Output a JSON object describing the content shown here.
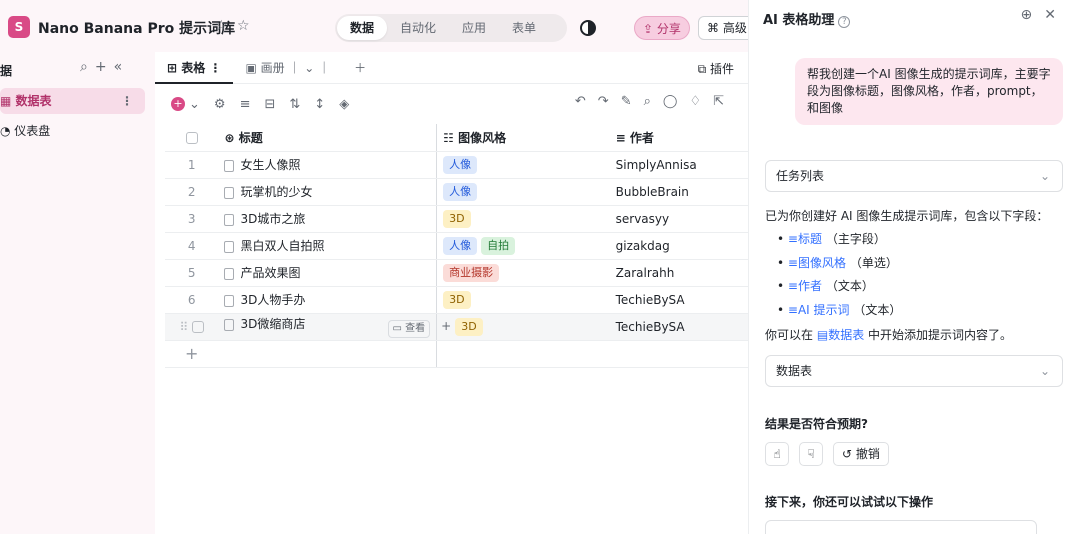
{
  "topbar": {
    "title": "Nano Banana Pro 提示词库",
    "nav_tabs": [
      "数据",
      "自动化",
      "应用",
      "表单"
    ],
    "active_tab": "数据",
    "share_label": "分享",
    "advanced_label": "高级"
  },
  "sidebar": {
    "heading": "据",
    "items": [
      {
        "label": "数据表",
        "active": true
      },
      {
        "label": "仪表盘",
        "active": false
      }
    ]
  },
  "views": {
    "tabs": [
      {
        "label": "表格",
        "active": true
      },
      {
        "label": "画册",
        "active": false
      }
    ],
    "plugin_label": "插件"
  },
  "table": {
    "columns": [
      "标题",
      "图像风格",
      "作者"
    ],
    "rows": [
      {
        "num": "1",
        "title": "女生人像照",
        "styles": [
          {
            "text": "人像",
            "bg": "#dde8fb",
            "fg": "#245bdb"
          }
        ],
        "author": "SimplyAnnisa"
      },
      {
        "num": "2",
        "title": "玩掌机的少女",
        "styles": [
          {
            "text": "人像",
            "bg": "#dde8fb",
            "fg": "#245bdb"
          }
        ],
        "author": "BubbleBrain"
      },
      {
        "num": "3",
        "title": "3D城市之旅",
        "styles": [
          {
            "text": "3D",
            "bg": "#fdf0c4",
            "fg": "#8f6100"
          }
        ],
        "author": "servasyy"
      },
      {
        "num": "4",
        "title": "黑白双人自拍照",
        "styles": [
          {
            "text": "人像",
            "bg": "#dde8fb",
            "fg": "#245bdb"
          },
          {
            "text": "自拍",
            "bg": "#d9f2dd",
            "fg": "#237b36"
          }
        ],
        "author": "gizakdag"
      },
      {
        "num": "5",
        "title": "产品效果图",
        "styles": [
          {
            "text": "商业摄影",
            "bg": "#fbdcd8",
            "fg": "#b3352a"
          }
        ],
        "author": "Zaralrahh"
      },
      {
        "num": "6",
        "title": "3D人物手办",
        "styles": [
          {
            "text": "3D",
            "bg": "#fdf0c4",
            "fg": "#8f6100"
          }
        ],
        "author": "TechieBySA"
      },
      {
        "num": "",
        "title": "3D微缩商店",
        "styles": [
          {
            "text": "3D",
            "bg": "#fdf0c4",
            "fg": "#8f6100"
          }
        ],
        "author": "TechieBySA",
        "hover": true,
        "view_label": "查看"
      }
    ]
  },
  "panel": {
    "title": "AI 表格助理",
    "user_message": "帮我创建一个AI 图像生成的提示词库，主要字段为图像标题，图像风格，作者，prompt，和图像",
    "task_list_label": "任务列表",
    "intro": "已为你创建好 AI 图像生成提示词库，包含以下字段：",
    "fields": [
      {
        "name": "标题",
        "note": "（主字段）"
      },
      {
        "name": "图像风格",
        "note": "（单选）"
      },
      {
        "name": "作者",
        "note": "（文本）"
      },
      {
        "name": "AI 提示词",
        "note": "（文本）"
      }
    ],
    "hint_prefix": "你可以在",
    "hint_link": "数据表",
    "hint_suffix": "中开始添加提示词内容了。",
    "table_dropdown": "数据表",
    "question": "结果是否符合预期?",
    "undo_label": "撤销",
    "next_heading": "接下来，你还可以试试以下操作"
  }
}
